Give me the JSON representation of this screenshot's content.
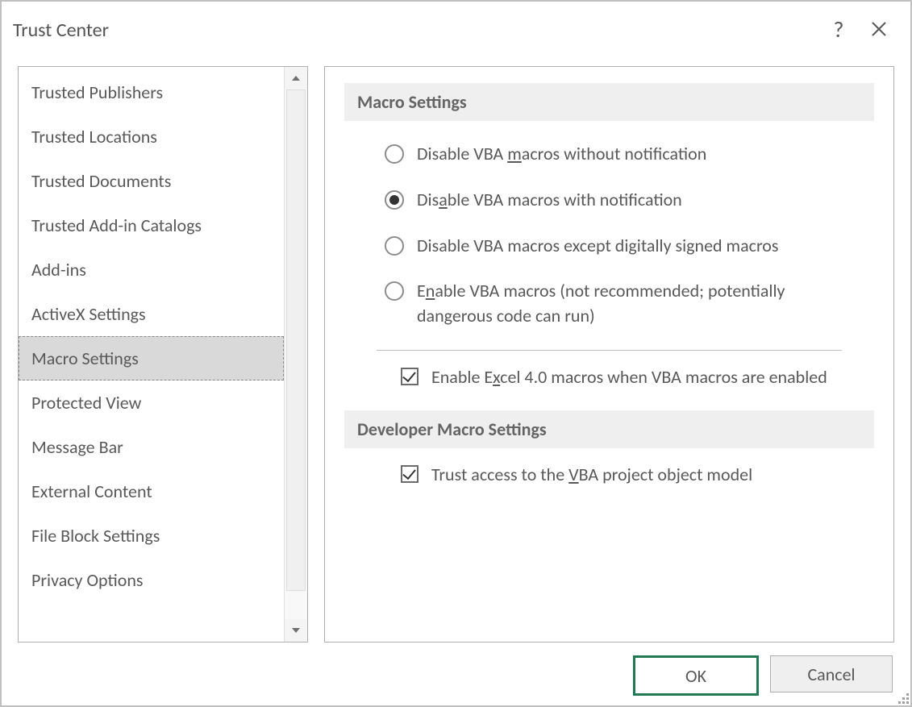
{
  "dialog": {
    "title": "Trust Center",
    "help_glyph": "?",
    "ok_label": "OK",
    "cancel_label": "Cancel"
  },
  "sidebar": {
    "items": [
      {
        "label": "Trusted Publishers",
        "selected": false
      },
      {
        "label": "Trusted Locations",
        "selected": false
      },
      {
        "label": "Trusted Documents",
        "selected": false
      },
      {
        "label": "Trusted Add-in Catalogs",
        "selected": false
      },
      {
        "label": "Add-ins",
        "selected": false
      },
      {
        "label": "ActiveX Settings",
        "selected": false
      },
      {
        "label": "Macro Settings",
        "selected": true
      },
      {
        "label": "Protected View",
        "selected": false
      },
      {
        "label": "Message Bar",
        "selected": false
      },
      {
        "label": "External Content",
        "selected": false
      },
      {
        "label": "File Block Settings",
        "selected": false
      },
      {
        "label": "Privacy Options",
        "selected": false
      }
    ]
  },
  "section1": {
    "title": "Macro Settings",
    "radios": [
      {
        "label_pre": "Disable VBA ",
        "accel": "m",
        "label_post": "acros without notification",
        "checked": false
      },
      {
        "label_pre": "Dis",
        "accel": "a",
        "label_post": "ble VBA macros with notification",
        "checked": true
      },
      {
        "label_pre": "Disable VBA macros except di",
        "accel": "g",
        "label_post": "itally signed macros",
        "checked": false
      },
      {
        "label_pre": "E",
        "accel": "n",
        "label_post": "able VBA macros (not recommended; potentially dangerous code can run)",
        "checked": false
      }
    ],
    "checkbox": {
      "label_pre": "Enable E",
      "accel": "x",
      "label_post": "cel 4.0 macros when VBA macros are enabled",
      "checked": true
    }
  },
  "section2": {
    "title": "Developer Macro Settings",
    "checkbox": {
      "label_pre": "Trust access to the ",
      "accel": "V",
      "label_post": "BA project object model",
      "checked": true
    }
  }
}
